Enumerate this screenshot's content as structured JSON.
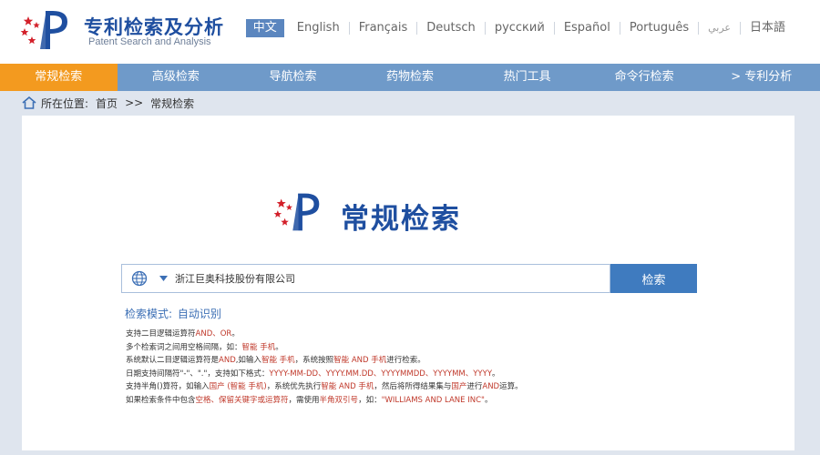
{
  "header": {
    "title": "专利检索及分析",
    "subtitle": "Patent Search and Analysis",
    "languages": [
      "中文",
      "English",
      "Français",
      "Deutsch",
      "русский",
      "Español",
      "Português",
      "عربي",
      "日本語"
    ]
  },
  "nav": {
    "items": [
      "常规检索",
      "高级检索",
      "导航检索",
      "药物检索",
      "热门工具",
      "命令行检索",
      "> 专利分析"
    ],
    "active_index": 0
  },
  "breadcrumb": {
    "prefix": "所在位置:",
    "home": "首页",
    "separator": ">>",
    "current": "常规检索"
  },
  "main": {
    "title": "常规检索",
    "search": {
      "value": "浙江巨奥科技股份有限公司",
      "button": "检索"
    },
    "mode_label": "检索模式:",
    "mode_value": "自动识别",
    "help": {
      "l1a": "支持二目逻辑运算符",
      "l1b": "AND、OR",
      "l1c": "。",
      "l2a": "多个检索词之间用空格间隔，如：",
      "l2b": "智能 手机",
      "l2c": "。",
      "l3a": "系统默认二目逻辑运算符是",
      "l3b": "AND",
      "l3c": ",如输入",
      "l3d": "智能 手机",
      "l3e": "，系统按照",
      "l3f": "智能 AND 手机",
      "l3g": "进行检索。",
      "l4a": "日期支持间隔符\"-\"、\".\"，支持如下格式：",
      "l4b": "YYYY-MM-DD、YYYY.MM.DD、YYYYMMDD、YYYYMM、YYYY",
      "l4c": "。",
      "l5a": "支持半角()算符，如输入",
      "l5b": "国产 (智能 手机)",
      "l5c": "，系统优先执行",
      "l5d": "智能 AND 手机",
      "l5e": "，然后将所得结果集与",
      "l5f": "国产",
      "l5g": "进行",
      "l5h": "AND",
      "l5i": "运算。",
      "l6a": "如果检索条件中包含",
      "l6b": "空格、保留关键字或运算符",
      "l6c": "，需使用",
      "l6d": "半角双引号",
      "l6e": "，如：",
      "l6f": "\"WILLIAMS AND LANE INC\"",
      "l6g": "。"
    }
  },
  "colors": {
    "brand": "#1f4fa0",
    "nav": "#6f9ac9",
    "nav_active": "#f39a1f",
    "button": "#3f7bbf",
    "highlight": "#c0392b",
    "logo_red": "#d3202a"
  },
  "icons": [
    "logo-icon",
    "home-icon",
    "globe-icon",
    "caret-down-icon"
  ]
}
